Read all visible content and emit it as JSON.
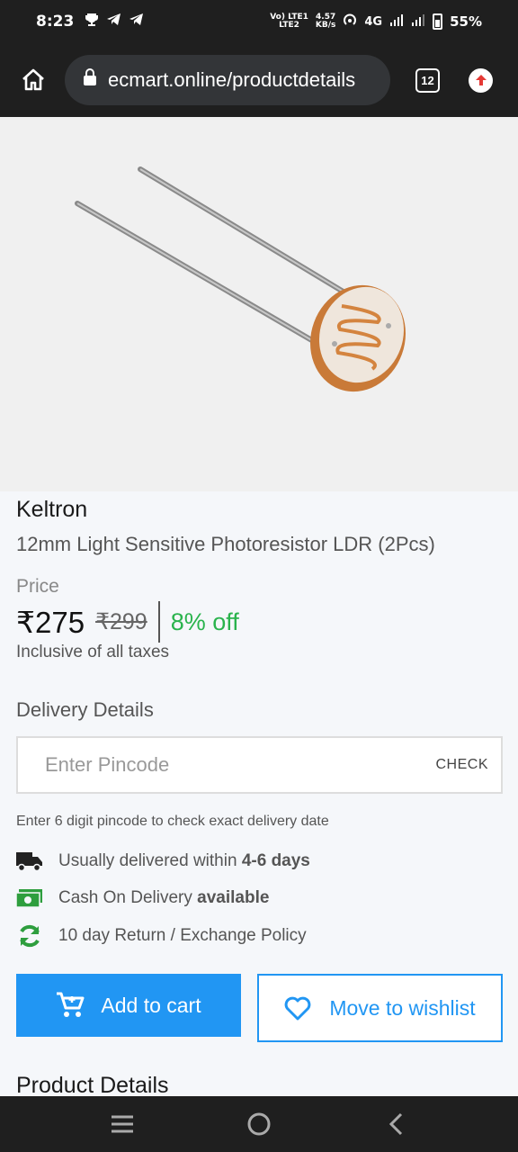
{
  "status_bar": {
    "time": "8:23",
    "network_speed_value": "4.57",
    "network_speed_unit": "KB/s",
    "carrier_badge_top": "Vo) LTE1",
    "carrier_badge_bottom": "LTE2",
    "network_type": "4G",
    "battery": "55%"
  },
  "browser": {
    "url": "ecmart.online/productdetails",
    "tab_count": "12"
  },
  "product": {
    "brand": "Keltron",
    "title": "12mm Light Sensitive Photoresistor LDR (2Pcs)",
    "price_label": "Price",
    "price": "₹275",
    "mrp": "₹299",
    "discount": "8% off",
    "tax_note": "Inclusive of all taxes"
  },
  "delivery": {
    "title": "Delivery Details",
    "pincode_placeholder": "Enter Pincode",
    "check_label": "CHECK",
    "hint": "Enter 6 digit pincode to check exact delivery date",
    "features": [
      {
        "icon": "truck-icon",
        "text": "Usually delivered within ",
        "bold": "4-6 days"
      },
      {
        "icon": "cash-icon",
        "text": "Cash On Delivery ",
        "bold": "available"
      },
      {
        "icon": "refresh-icon",
        "text": "10 day Return / Exchange Policy",
        "bold": ""
      }
    ]
  },
  "actions": {
    "add_to_cart": "Add to cart",
    "move_to_wishlist": "Move to wishlist"
  },
  "sections": {
    "product_details": "Product Details"
  },
  "colors": {
    "accent": "#2196f3",
    "discount": "#2ab34d",
    "truck_icon": "#222222",
    "cash_icon": "#2e9e3e",
    "refresh_icon": "#2e9e3e"
  }
}
